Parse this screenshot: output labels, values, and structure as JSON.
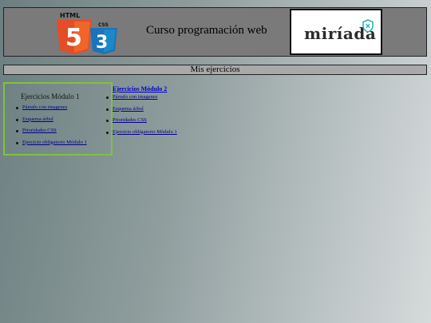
{
  "header": {
    "course_title": "Curso programación web",
    "html5_label": "HTML",
    "css3_label": "CSS",
    "brand": "miríada"
  },
  "section_title": "Mis ejercicios",
  "module1": {
    "title": "Ejercicios Módulo 1",
    "items": [
      "Párrafo con imagenes",
      "Esquema árbol",
      "Prioridades CSS",
      "Ejercicio obligatorio Módulo 1"
    ]
  },
  "module2": {
    "title": "Ejercicios Módulo 2",
    "items": [
      "Párrafo con imagenes",
      "Esquema árbol",
      "Prioridades CSS",
      "Ejercicio obligatorio Módulo 1"
    ]
  },
  "colors": {
    "html5": "#e44d26",
    "css3": "#1b73ba",
    "module1_border": "#7fc241",
    "brand_shield": "#2bb5b0"
  }
}
